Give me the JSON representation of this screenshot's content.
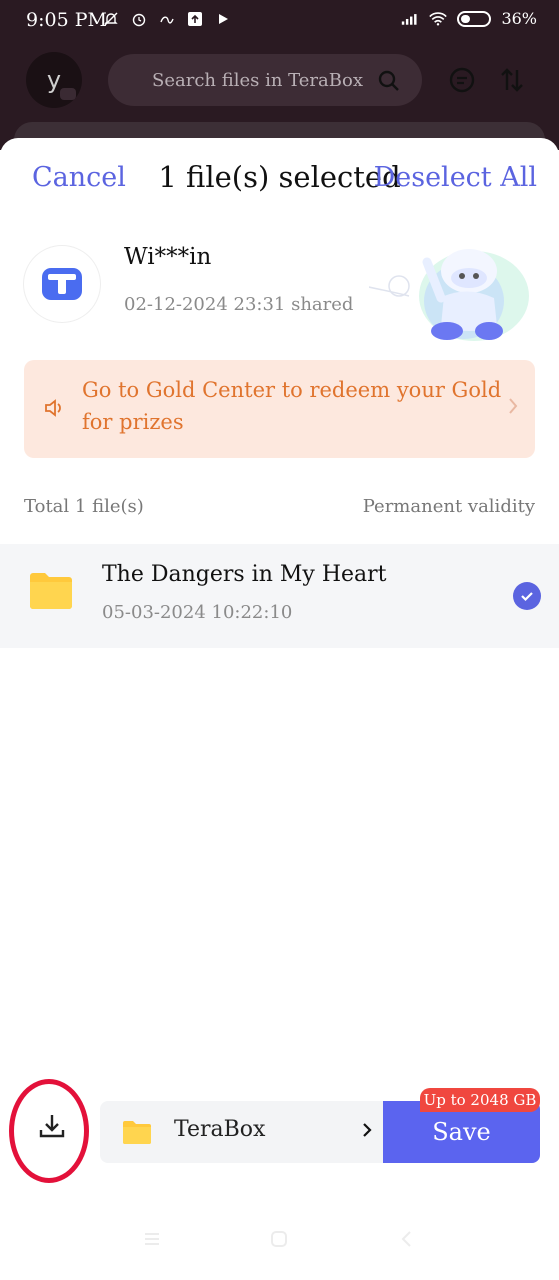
{
  "status_bar": {
    "time": "9:05 PM",
    "battery_percent": "36%",
    "battery_level": 0.36
  },
  "background_app": {
    "avatar_initial": "y",
    "search_placeholder": "Search files in TeraBox"
  },
  "sheet": {
    "cancel_label": "Cancel",
    "title": "1 file(s) selected",
    "deselect_label": "Deselect All",
    "sharer": {
      "name": "Wi***in",
      "date": "02-12-2024 23:31 shared"
    },
    "gold_banner": {
      "text": "Go to Gold Center to redeem your Gold for prizes"
    },
    "files_header": {
      "total": "Total 1 file(s)",
      "validity": "Permanent validity"
    },
    "files": [
      {
        "name": "The Dangers in My Heart",
        "date": "05-03-2024  10:22:10",
        "selected": true
      }
    ]
  },
  "bottom_bar": {
    "destination_label": "TeraBox",
    "save_label": "Save",
    "quota_badge": "Up to 2048 GB"
  },
  "colors": {
    "accent": "#5b64e0",
    "save_button": "#5b64ef",
    "banner_bg": "#fde8de",
    "banner_text": "#e0742e",
    "quota_badge": "#f0473f",
    "annotation": "#e3113a",
    "folder": "#ffc93c"
  }
}
